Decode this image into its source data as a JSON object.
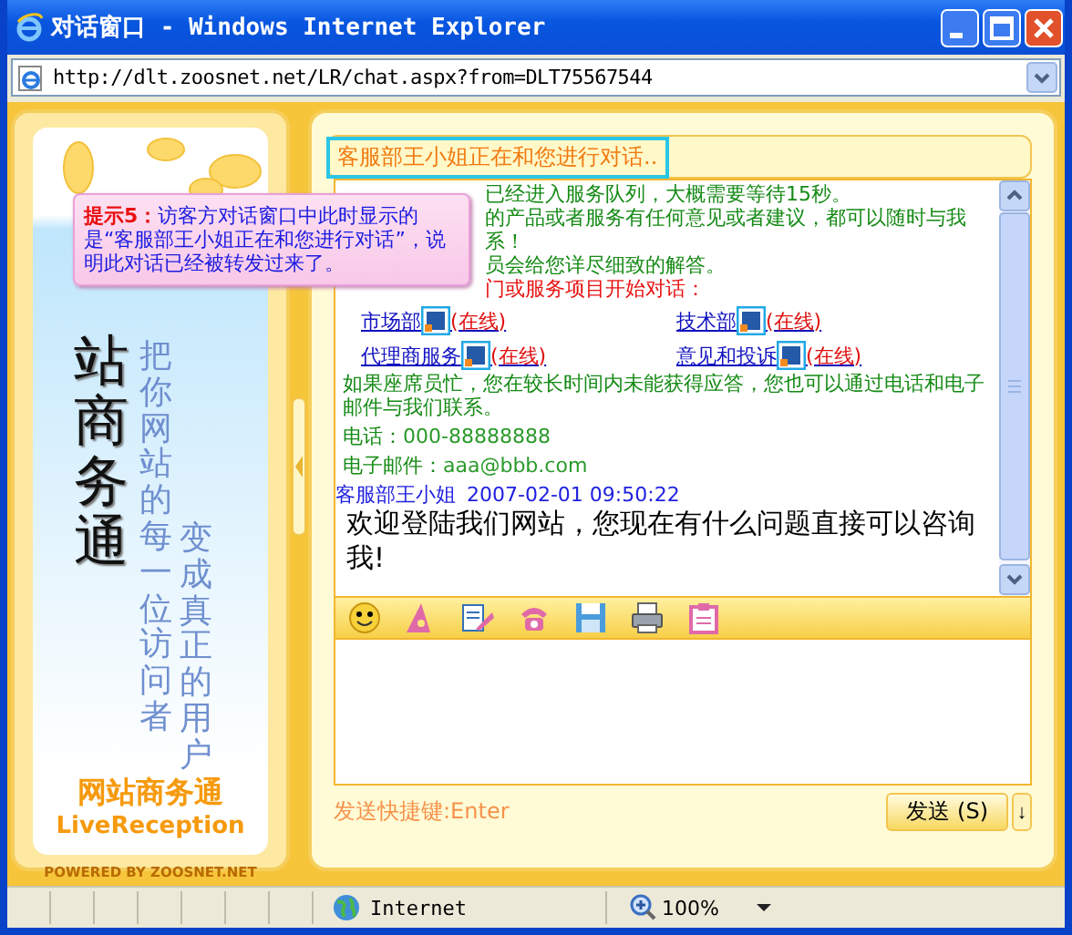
{
  "window": {
    "title": "对话窗口 - Windows Internet Explorer"
  },
  "address_bar": {
    "url": "http://dlt.zoosnet.net/LR/chat.aspx?from=DLT75567544"
  },
  "sidebar": {
    "slogan_main": "站商务通",
    "slogan_columns": [
      "把你网站的每一位访问者",
      "变成真正的用户"
    ],
    "brand": "网站商务通",
    "brand_en": "LiveReception",
    "powered_by": "POWERED BY ZOOSNET.NET"
  },
  "tooltip": {
    "text": "**提示5：**访客方对话窗口中此时显示的是“客服部王小姐正在和您进行对话”，说明此对话已经被转发过来了。"
  },
  "chat": {
    "status": "客服部王小姐正在和您进行对话..",
    "notice_lines": [
      {
        "kind": "info",
        "text": "已经进入服务队列，大概需要等待15秒。"
      },
      {
        "kind": "info",
        "text": "的产品或者服务有任何意见或者建议，都可以随时与我"
      },
      {
        "kind": "info",
        "text": "系！"
      },
      {
        "kind": "info",
        "text": "员会给您详尽细致的解答。"
      },
      {
        "kind": "prompt",
        "text": "门或服务项目开始对话："
      }
    ],
    "departments": [
      {
        "name": "市场部",
        "status": "(在线)"
      },
      {
        "name": "技术部",
        "status": "(在线)"
      },
      {
        "name": "代理商服务",
        "status": "(在线)"
      },
      {
        "name": "意见和投诉",
        "status": "(在线)"
      }
    ],
    "contact_note": "如果座席员忙，您在较长时间内未能获得应答，您也可以通过电话和电子邮件与我们联系。",
    "phone_label": "电话：",
    "phone": "000-88888888",
    "email_label": "电子邮件：",
    "email": "aaa@bbb.com",
    "messages": [
      {
        "sender": "客服部王小姐",
        "time": "2007-02-01 09:50:22",
        "text": "欢迎登陆我们网站，您现在有什么问题直接可以咨询我!"
      }
    ]
  },
  "composer": {
    "shortcut_label": "发送快捷键:",
    "shortcut_key": "Enter",
    "send_button": "发送 (S)",
    "more_button": "↓"
  },
  "status_bar": {
    "zone": "Internet",
    "zoom": "100%"
  }
}
